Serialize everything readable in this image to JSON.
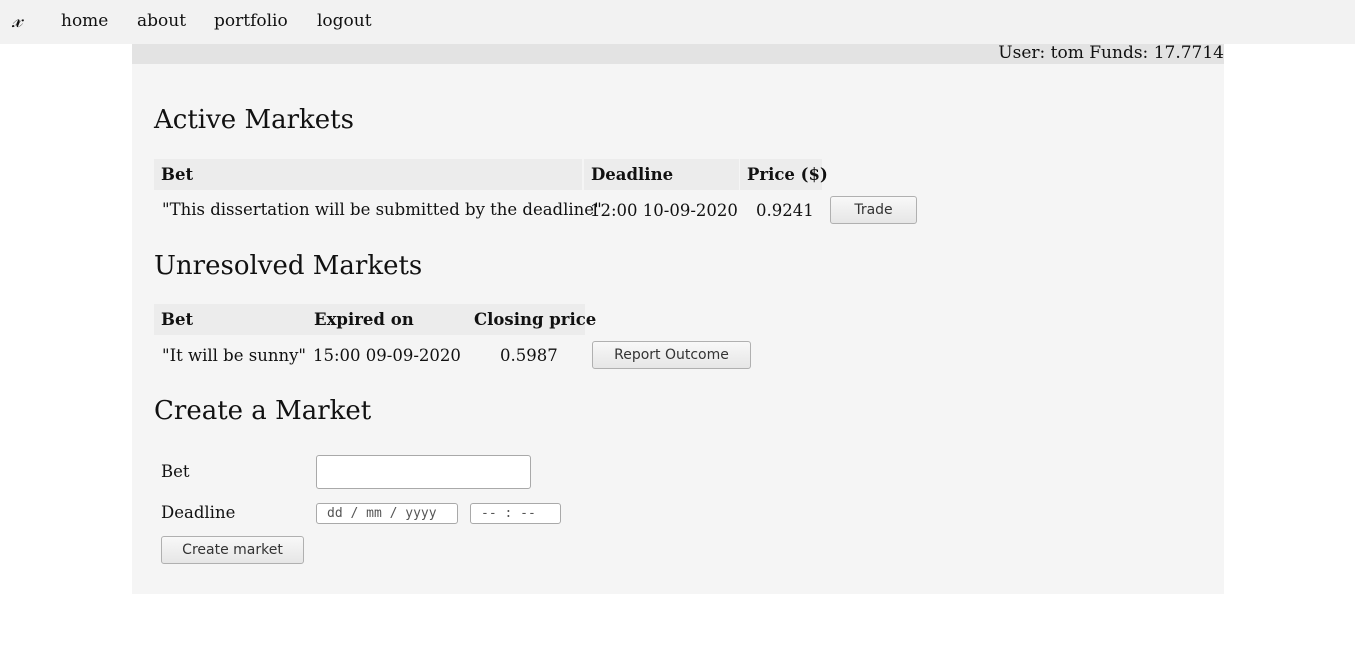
{
  "nav": {
    "logo": "𝓍",
    "links": [
      "home",
      "about",
      "portfolio",
      "logout"
    ]
  },
  "userbar": {
    "text": "User: tom Funds: 17.7714"
  },
  "active": {
    "title": "Active Markets",
    "headers": [
      "Bet",
      "Deadline",
      "Price ($)"
    ],
    "rows": [
      {
        "bet": "\"This dissertation will be submitted by the deadline\"",
        "deadline": "12:00 10-09-2020",
        "price": "0.9241",
        "action": "Trade"
      }
    ]
  },
  "unresolved": {
    "title": "Unresolved Markets",
    "headers": [
      "Bet",
      "Expired on",
      "Closing price"
    ],
    "rows": [
      {
        "bet": "\"It will be sunny\"",
        "expired": "15:00 09-09-2020",
        "closing": "0.5987",
        "action": "Report Outcome"
      }
    ]
  },
  "create": {
    "title": "Create a Market",
    "bet_label": "Bet",
    "bet_value": "",
    "deadline_label": "Deadline",
    "date_placeholder": "dd / mm / yyyy",
    "time_placeholder": "-- : --",
    "submit": "Create market"
  }
}
